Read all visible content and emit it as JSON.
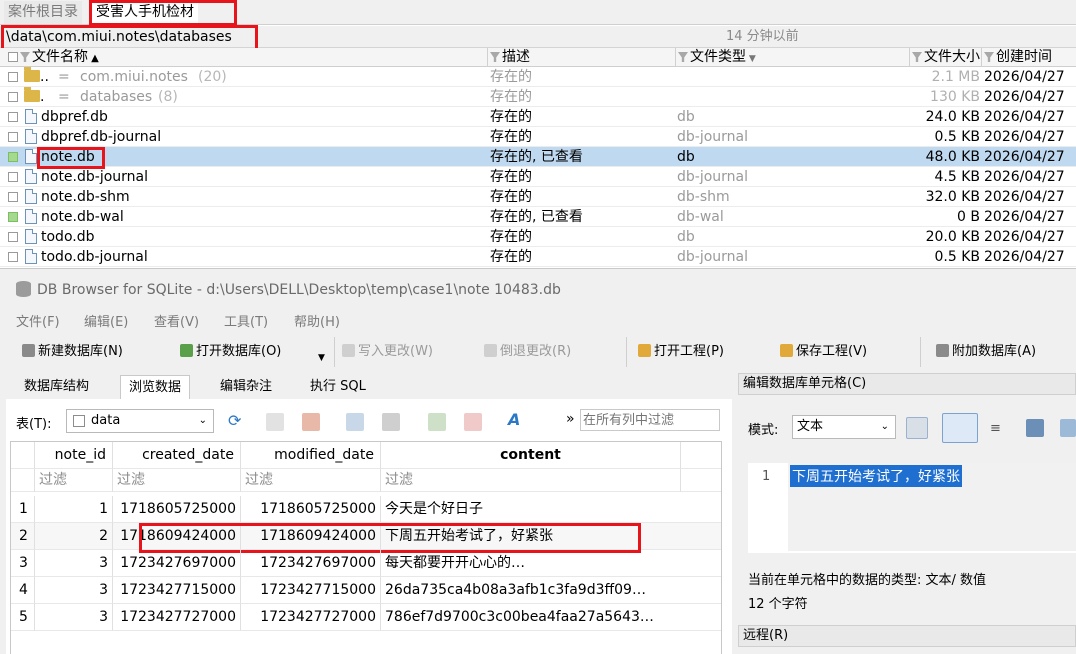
{
  "file_tabs": [
    "案件根目录",
    "受害人手机检材"
  ],
  "path": {
    "text": "\\data\\com.miui.notes\\databases",
    "modified": "14 分钟以前"
  },
  "file_columns": {
    "name": "文件名称",
    "desc": "描述",
    "type": "文件类型",
    "size": "文件大小",
    "created": "创建时间"
  },
  "parent_rows": [
    {
      "dots": "..",
      "eq": "=",
      "name": "com.miui.notes",
      "count": "(20)",
      "desc": "存在的",
      "size": "2.1 MB",
      "created": "2026/04/27"
    },
    {
      "dots": ".",
      "eq": "=",
      "name": "databases",
      "count": "(8)",
      "desc": "存在的",
      "size": "130 KB",
      "created": "2026/04/27"
    }
  ],
  "files": [
    {
      "name": "dbpref.db",
      "desc": "存在的",
      "type": "db",
      "size": "24.0 KB",
      "created": "2026/04/27"
    },
    {
      "name": "dbpref.db-journal",
      "desc": "存在的",
      "type": "db-journal",
      "size": "0.5 KB",
      "created": "2026/04/27"
    },
    {
      "name": "note.db",
      "desc": "存在的, 已查看",
      "type": "db",
      "size": "48.0 KB",
      "created": "2026/04/27"
    },
    {
      "name": "note.db-journal",
      "desc": "存在的",
      "type": "db-journal",
      "size": "4.5 KB",
      "created": "2026/04/27"
    },
    {
      "name": "note.db-shm",
      "desc": "存在的",
      "type": "db-shm",
      "size": "32.0 KB",
      "created": "2026/04/27"
    },
    {
      "name": "note.db-wal",
      "desc": "存在的, 已查看",
      "type": "db-wal",
      "size": "0 B",
      "created": "2026/04/27"
    },
    {
      "name": "todo.db",
      "desc": "存在的",
      "type": "db",
      "size": "20.0 KB",
      "created": "2026/04/27"
    },
    {
      "name": "todo.db-journal",
      "desc": "存在的",
      "type": "db-journal",
      "size": "0.5 KB",
      "created": "2026/04/27"
    }
  ],
  "db_window": {
    "title": "DB Browser for SQLite - d:\\Users\\DELL\\Desktop\\temp\\case1\\note 10483.db",
    "menu": [
      "文件(F)",
      "编辑(E)",
      "查看(V)",
      "工具(T)",
      "帮助(H)"
    ],
    "toolbar": {
      "new_db": "新建数据库(N)",
      "open_db": "打开数据库(O)",
      "write": "写入更改(W)",
      "revert": "倒退更改(R)",
      "open_proj": "打开工程(P)",
      "save_proj": "保存工程(V)",
      "attach": "附加数据库(A)"
    },
    "tabs": [
      "数据库结构",
      "浏览数据",
      "编辑杂注",
      "执行 SQL"
    ],
    "table_label": "表(T):",
    "table_value": "data",
    "filter_all_placeholder": "在所有列中过滤",
    "more": "»",
    "columns": [
      "note_id",
      "created_date",
      "modified_date",
      "content"
    ],
    "filter_label": "过滤",
    "rows": [
      {
        "n": "1",
        "note_id": "1",
        "created": "1718605725000",
        "modified": "1718605725000",
        "content": "今天是个好日子"
      },
      {
        "n": "2",
        "note_id": "2",
        "created": "1718609424000",
        "modified": "1718609424000",
        "content": "下周五开始考试了，好紧张"
      },
      {
        "n": "3",
        "note_id": "3",
        "created": "1723427697000",
        "modified": "1723427697000",
        "content": "每天都要开开心心的…"
      },
      {
        "n": "4",
        "note_id": "3",
        "created": "1723427715000",
        "modified": "1723427715000",
        "content": "26da735ca4b08a3afb1c3fa9d3ff09…"
      },
      {
        "n": "5",
        "note_id": "3",
        "created": "1723427727000",
        "modified": "1723427727000",
        "content": "786ef7d9700c3c00bea4faa27a5643…"
      }
    ],
    "edit_panel": {
      "title": "编辑数据库单元格(C)",
      "mode_label": "模式:",
      "mode_value": "文本",
      "line_no": "1",
      "cell_text": "下周五开始考试了，好紧张",
      "type_info": "当前在单元格中的数据的类型: 文本/ 数值",
      "char_count": "12 个字符",
      "remote_title": "远程(R)"
    }
  },
  "colors": {
    "highlight": "#bfd9f1",
    "red": "#e8141b",
    "selection": "#1f6fd1"
  }
}
